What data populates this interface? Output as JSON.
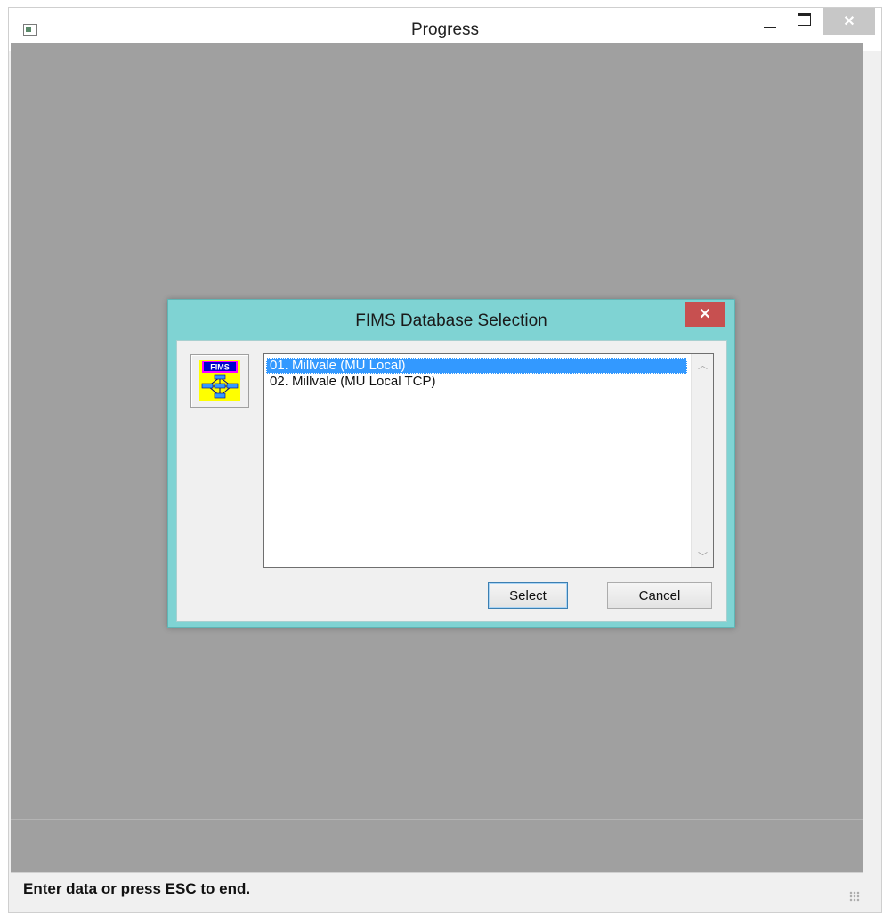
{
  "window": {
    "title": "Progress",
    "controls": {
      "minimize": "—",
      "maximize": "□",
      "close": "✕"
    }
  },
  "dialog": {
    "title": "FIMS Database Selection",
    "close": "✕",
    "logo_text": "FIMS",
    "list_items": [
      {
        "label": "01. Millvale (MU Local)",
        "selected": true
      },
      {
        "label": "02. Millvale (MU Local TCP)",
        "selected": false
      }
    ],
    "select_label": "Select",
    "cancel_label": "Cancel"
  },
  "status": {
    "text": "Enter data or press ESC to end."
  },
  "colors": {
    "dialog_frame": "#7fd3d3",
    "dialog_close": "#c75050",
    "selection": "#3399ff",
    "client_bg": "#a0a0a0"
  }
}
